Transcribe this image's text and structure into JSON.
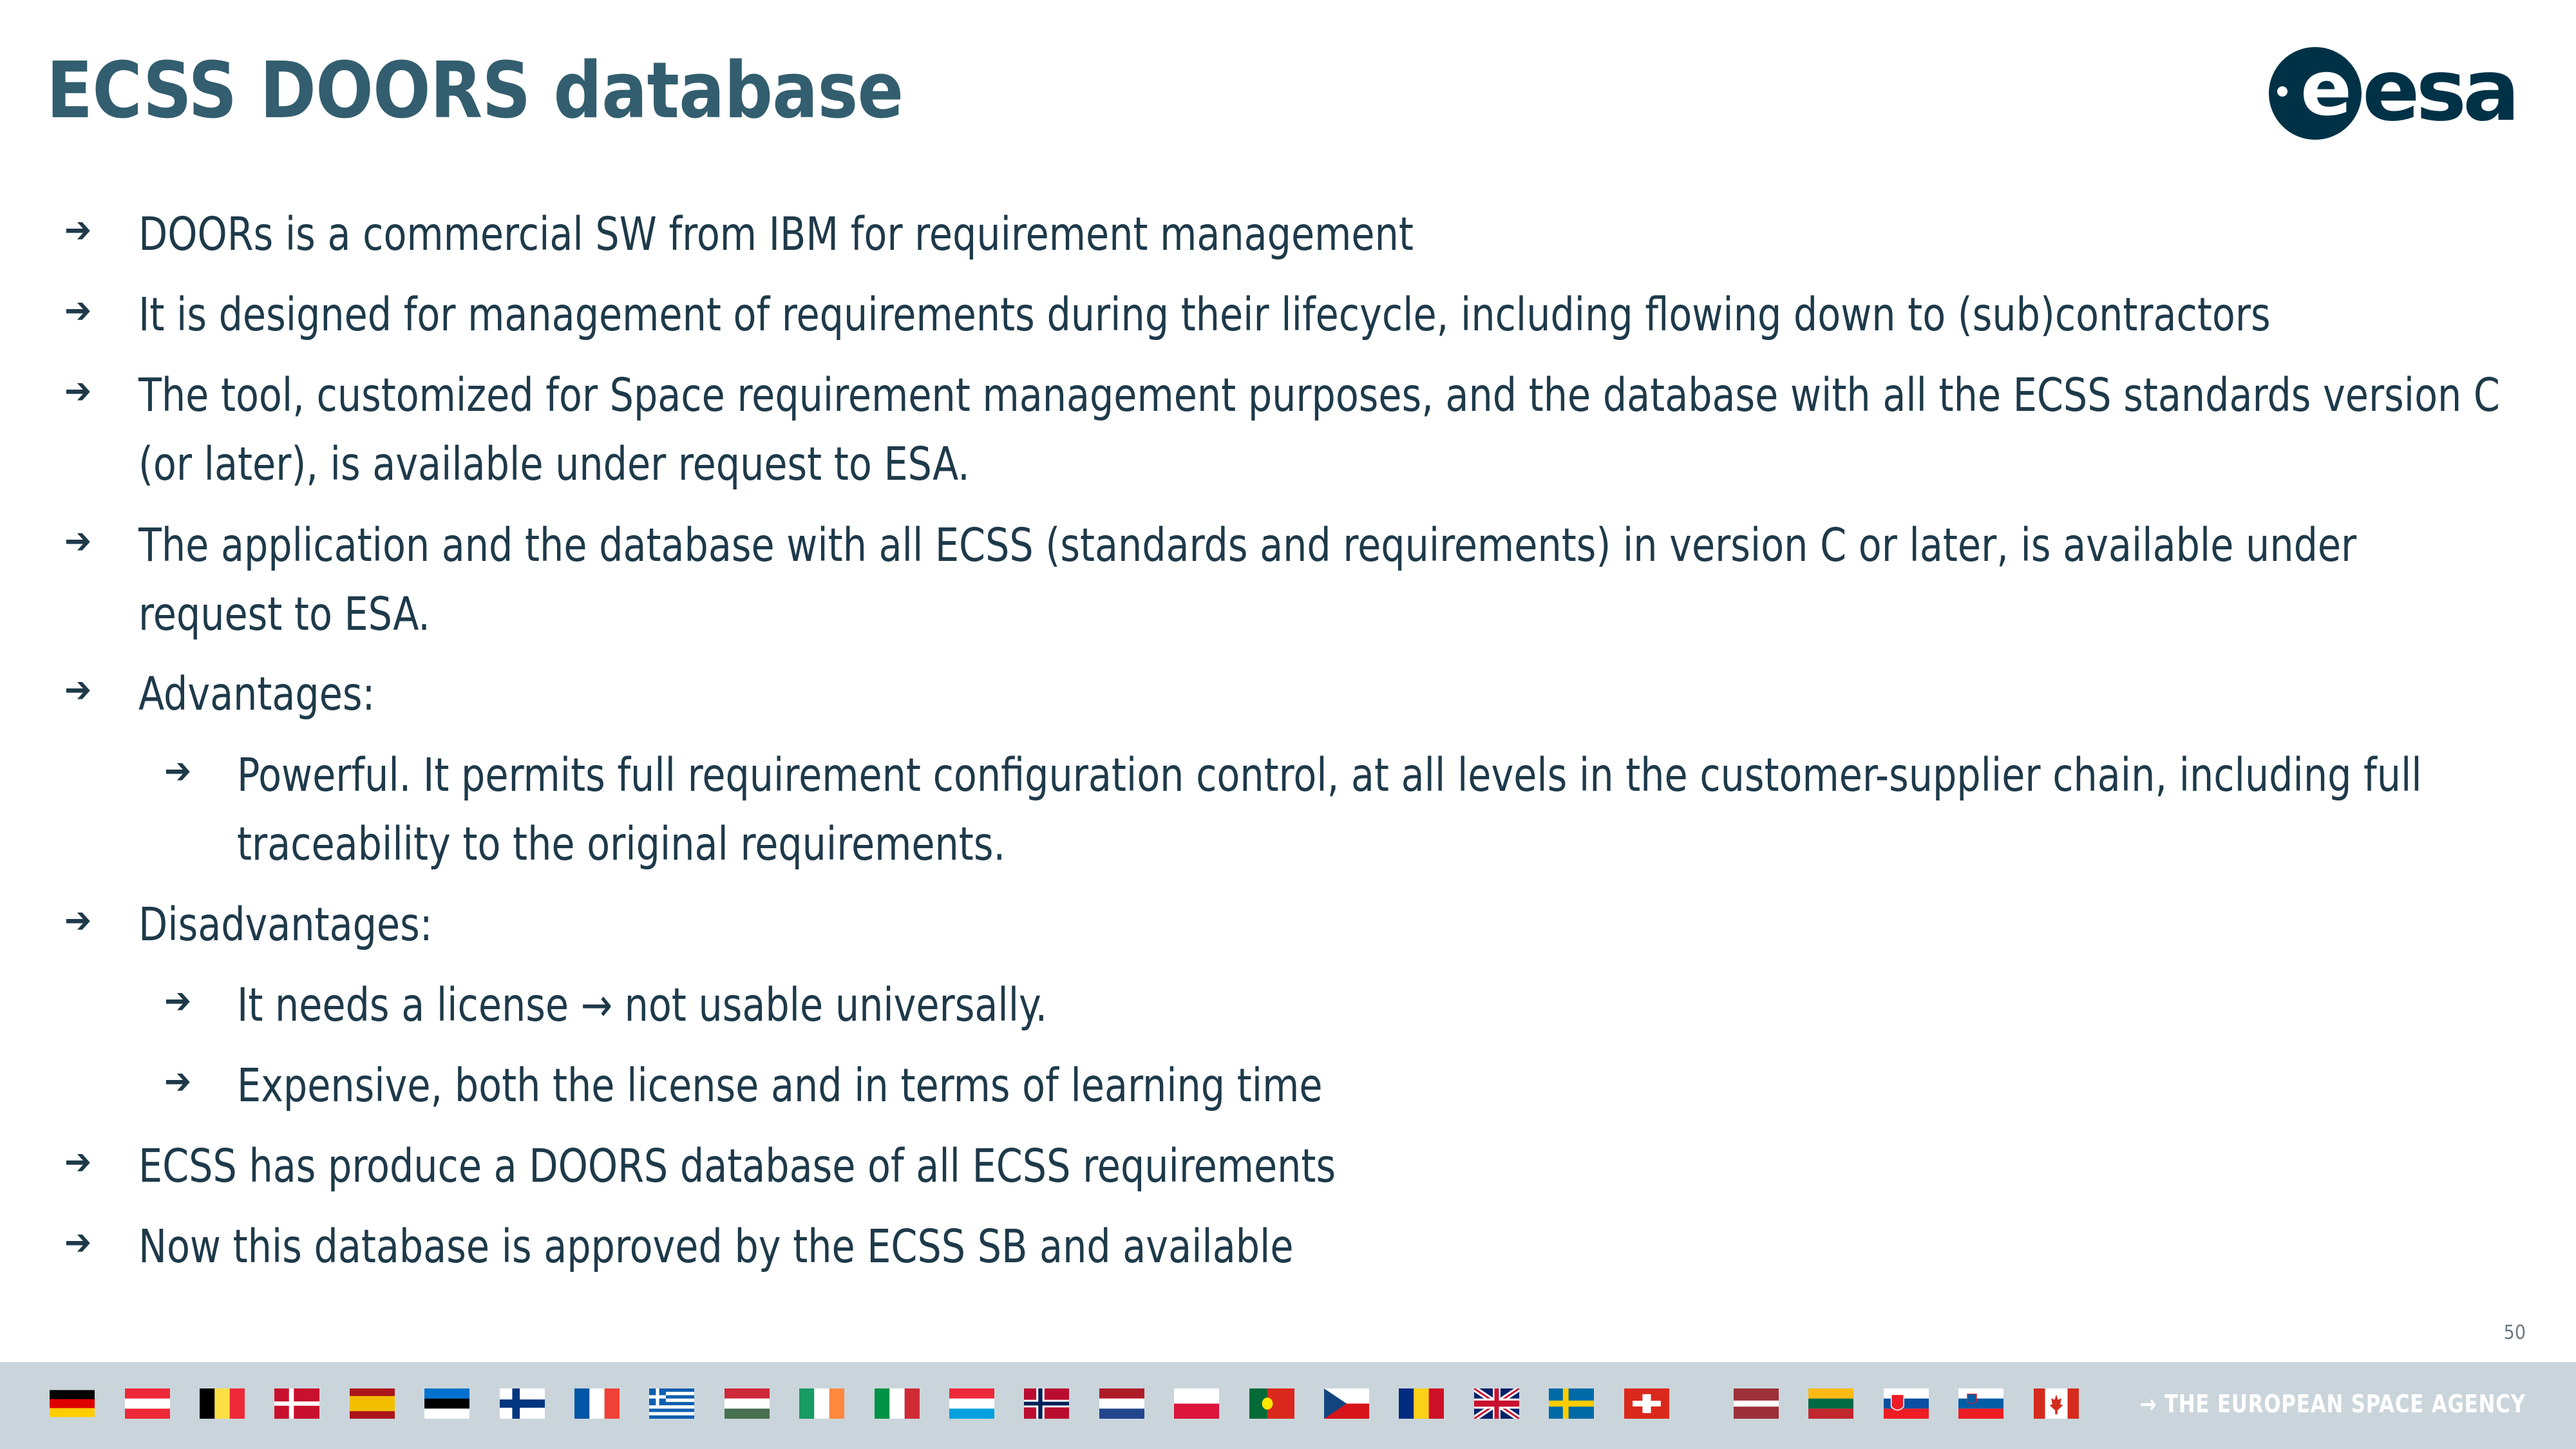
{
  "slide": {
    "title": "ECSS DOORS database",
    "page_number": "50"
  },
  "logo": {
    "text": "esa"
  },
  "bullets": [
    {
      "level": 1,
      "text": "DOORs is a commercial SW from IBM for requirement management"
    },
    {
      "level": 1,
      "text": "It is designed for management of requirements during their lifecycle, including flowing down to (sub)contractors"
    },
    {
      "level": 1,
      "text": "The tool, customized for Space requirement management purposes, and the database with all the ECSS standards version C (or later), is available under request to ESA."
    },
    {
      "level": 1,
      "text": "The application and the database with all ECSS (standards and requirements) in version C or later, is available under request to ESA."
    },
    {
      "level": 1,
      "text": "Advantages:"
    },
    {
      "level": 2,
      "text": "Powerful. It permits full requirement configuration control, at all levels in the customer-supplier chain, including full traceability to the original requirements."
    },
    {
      "level": 1,
      "text": "Disadvantages:"
    },
    {
      "level": 2,
      "text": "It needs a license → not usable universally."
    },
    {
      "level": 2,
      "text": "Expensive, both the license and in terms of learning time"
    },
    {
      "level": 1,
      "text": "ECSS has produce a DOORS database of all ECSS requirements"
    },
    {
      "level": 1,
      "text": "Now this database is approved by the ECSS SB and available"
    }
  ],
  "footer": {
    "agency_text": "→ THE EUROPEAN SPACE AGENCY",
    "flags": [
      "germany-flag",
      "austria-flag",
      "belgium-flag",
      "denmark-flag",
      "spain-flag",
      "estonia-flag",
      "finland-flag",
      "france-flag",
      "greece-flag",
      "hungary-flag",
      "ireland-flag",
      "italy-flag",
      "luxembourg-flag",
      "norway-flag",
      "netherlands-flag",
      "poland-flag",
      "portugal-flag",
      "czech-republic-flag",
      "romania-flag",
      "united-kingdom-flag",
      "sweden-flag",
      "switzerland-flag",
      "latvia-flag",
      "lithuania-flag",
      "slovakia-flag",
      "slovenia-flag",
      "canada-flag"
    ]
  },
  "colors": {
    "title": "#335e6f",
    "body_text": "#1e3a4a",
    "footer_bar": "#cad5db",
    "logo": "#003247"
  }
}
